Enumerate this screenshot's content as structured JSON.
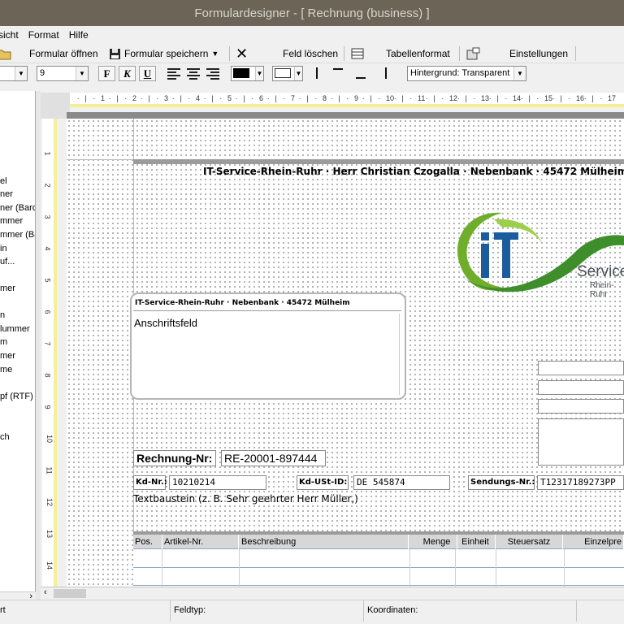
{
  "window": {
    "title": "Formulardesigner - [ Rechnung (business) ]"
  },
  "menu": {
    "items": [
      "sicht",
      "Format",
      "Hilfe"
    ]
  },
  "toolbar": {
    "open_label": "Formular öffnen",
    "save_label": "Formular speichern",
    "delete_field_label": "Feld löschen",
    "table_format_label": "Tabellenformat",
    "settings_label": "Einstellungen"
  },
  "format_bar": {
    "font_size": "9",
    "bold": "F",
    "italic": "K",
    "underline": "U",
    "background": "Hintergrund: Transparent"
  },
  "field_list": {
    "items": [
      "el",
      "ner",
      "ner (Barc",
      "mmer",
      "mmer (Ba",
      "in",
      "uf...",
      "mer",
      "n",
      "lummer",
      "m",
      "mer",
      "me",
      "pf (RTF)",
      "ch"
    ]
  },
  "ruler": {
    "labels": [
      "1",
      "2",
      "3",
      "4",
      "5",
      "6",
      "7",
      "8",
      "9",
      "10",
      "11",
      "12",
      "13",
      "14",
      "15",
      "16",
      "17"
    ]
  },
  "vruler": {
    "labels": [
      "1",
      "2",
      "3",
      "4",
      "5",
      "6",
      "7",
      "8",
      "9",
      "10",
      "11",
      "12",
      "13",
      "14"
    ]
  },
  "form": {
    "sender_line": "IT-Service-Rhein-Ruhr · Herr Christian Czogalla · Nebenbank  · 45472 Mülheim",
    "address_sender": "IT-Service-Rhein-Ruhr · Nebenbank  · 45472 Mülheim",
    "address_label": "Anschriftsfeld",
    "logo_text": "Service",
    "logo_subtext": "Rhein-Ruhr",
    "invoice_label": "Rechnung-Nr:",
    "invoice_value": "RE-20001-897444",
    "customer_label": "Kd-Nr.:",
    "customer_value": "10210214",
    "vat_label": "Kd-USt-ID:",
    "vat_value": "DE 545874",
    "shipment_label": "Sendungs-Nr.:",
    "shipment_value": "T12317189273PP",
    "text_block": "Textbaustein (z. B. Sehr geehrter Herr Müller,)"
  },
  "table": {
    "columns": [
      "Pos.",
      "Artikel-Nr.",
      "Beschreibung",
      "Menge",
      "Einheit",
      "Steuersatz",
      "Einzelpre"
    ]
  },
  "status": {
    "left": "rt",
    "field_type_label": "Feldtyp:",
    "coordinates_label": "Koordinaten:"
  },
  "colors": {
    "titlebar": "#6b6457",
    "logo_green": "#6fae2b",
    "logo_blue": "#1b5c9e"
  }
}
